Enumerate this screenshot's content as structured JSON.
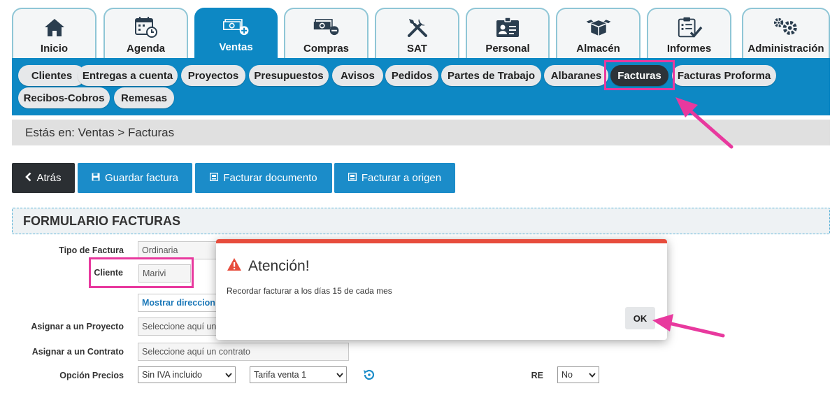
{
  "modules": [
    {
      "label": "Inicio",
      "icon": "home-icon"
    },
    {
      "label": "Agenda",
      "icon": "calendar-icon"
    },
    {
      "label": "Ventas",
      "icon": "money-plus-icon",
      "active": true
    },
    {
      "label": "Compras",
      "icon": "money-minus-icon"
    },
    {
      "label": "SAT",
      "icon": "tools-icon"
    },
    {
      "label": "Personal",
      "icon": "id-card-icon"
    },
    {
      "label": "Almacén",
      "icon": "boxes-icon"
    },
    {
      "label": "Informes",
      "icon": "clipboard-check-icon"
    },
    {
      "label": "Administración",
      "icon": "gears-icon"
    }
  ],
  "subnav": [
    "Clientes",
    "Entregas a cuenta",
    "Proyectos",
    "Presupuestos",
    "Avisos",
    "Pedidos",
    "Partes de Trabajo",
    "Albaranes",
    "Facturas",
    "Facturas Proforma",
    "Recibos-Cobros",
    "Remesas"
  ],
  "subnav_active": "Facturas",
  "breadcrumb": "Estás en: Ventas > Facturas",
  "actions": {
    "back": "Atrás",
    "save": "Guardar factura",
    "bill_document": "Facturar documento",
    "bill_origin": "Facturar a origen"
  },
  "form": {
    "title": "FORMULARIO FACTURAS",
    "invoice_type_label": "Tipo de Factura",
    "invoice_type_value": "Ordinaria",
    "client_label": "Cliente",
    "client_value": "Marivi",
    "show_address_link": "Mostrar direccion de",
    "project_label": "Asignar a un Proyecto",
    "project_placeholder": "Seleccione aquí un",
    "contract_label": "Asignar a un Contrato",
    "contract_placeholder": "Seleccione aquí un contrato",
    "price_option_label": "Opción Precios",
    "price_option_value": "Sin IVA incluido",
    "rate_value": "Tarifa venta 1",
    "re_label": "RE",
    "re_value": "No"
  },
  "modal": {
    "title": "Atención!",
    "message": "Recordar facturar a los días 15 de cada mes",
    "ok": "OK"
  },
  "colors": {
    "primary": "#0d88c4",
    "dark": "#2b2f33",
    "highlight": "#e8399e",
    "danger": "#e74c3c"
  }
}
